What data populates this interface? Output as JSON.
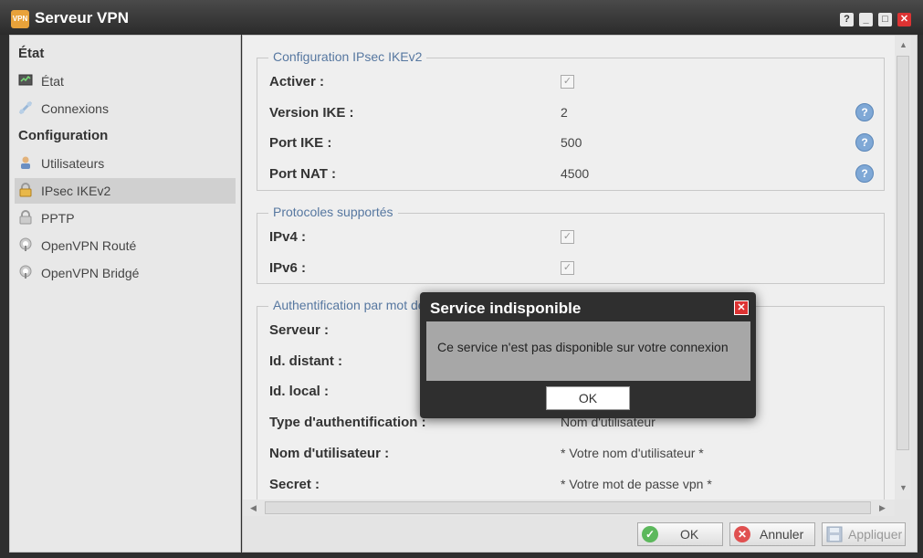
{
  "window": {
    "title": "Serveur VPN",
    "app_icon_text": "VPN",
    "controls": {
      "help": "?",
      "minimize": "_",
      "maximize": "□",
      "close": "✕"
    }
  },
  "sidebar": {
    "sections": [
      {
        "title": "État",
        "items": [
          {
            "label": "État",
            "icon": "status-monitor-icon"
          },
          {
            "label": "Connexions",
            "icon": "connections-icon"
          }
        ]
      },
      {
        "title": "Configuration",
        "items": [
          {
            "label": "Utilisateurs",
            "icon": "user-icon"
          },
          {
            "label": "IPsec IKEv2",
            "icon": "lock-icon",
            "active": true
          },
          {
            "label": "PPTP",
            "icon": "lock-icon"
          },
          {
            "label": "OpenVPN Routé",
            "icon": "openvpn-icon"
          },
          {
            "label": "OpenVPN Bridgé",
            "icon": "openvpn-icon"
          }
        ]
      }
    ]
  },
  "main": {
    "groups": [
      {
        "title": "Configuration IPsec IKEv2",
        "rows": [
          {
            "label": "Activer :",
            "checkbox": true
          },
          {
            "label": "Version IKE :",
            "value": "2",
            "help": true
          },
          {
            "label": "Port IKE :",
            "value": "500",
            "help": true
          },
          {
            "label": "Port NAT :",
            "value": "4500",
            "help": true
          }
        ]
      },
      {
        "title": "Protocoles supportés",
        "rows": [
          {
            "label": "IPv4 :",
            "checkbox": true
          },
          {
            "label": "IPv6 :",
            "checkbox": true
          }
        ]
      },
      {
        "title": "Authentification par mot de",
        "rows": [
          {
            "label": "Serveur :",
            "value": ""
          },
          {
            "label": "Id. distant :",
            "value": ""
          },
          {
            "label": "Id. local :",
            "value": ""
          },
          {
            "label": "Type d'authentification :",
            "value": "Nom d'utilisateur"
          },
          {
            "label": "Nom d'utilisateur :",
            "value": "* Votre nom d'utilisateur *"
          },
          {
            "label": "Secret :",
            "value": "* Votre mot de passe vpn *"
          }
        ]
      }
    ],
    "help_glyph": "?",
    "check_glyph": "✓"
  },
  "footer": {
    "ok": "OK",
    "cancel": "Annuler",
    "apply": "Appliquer"
  },
  "dialog": {
    "title": "Service indisponible",
    "message": "Ce service n'est pas disponible sur votre connexion",
    "ok": "OK",
    "close": "✕"
  },
  "colors": {
    "accent_legend": "#5677a0",
    "help_blue": "#7fa8d6",
    "close_red": "#dd3333",
    "ok_green": "#5cb85c",
    "cancel_red": "#e05050"
  }
}
